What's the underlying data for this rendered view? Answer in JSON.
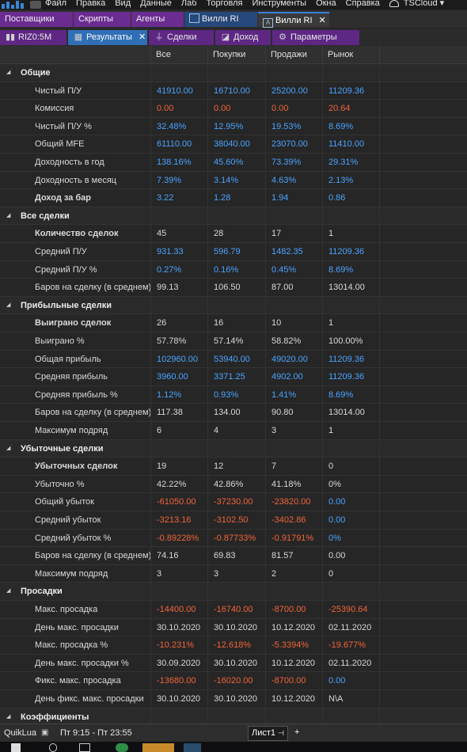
{
  "menu": [
    "Файл",
    "Правка",
    "Вид",
    "Данные",
    "Лаб",
    "Торговля",
    "Инструменты",
    "Окна",
    "Справка",
    "TSCloud ▾"
  ],
  "tabs_row1": [
    {
      "label": "Поставщики",
      "style": "purple"
    },
    {
      "label": "Скрипты",
      "style": "purple"
    },
    {
      "label": "Агенты",
      "style": "purple"
    },
    {
      "label": "Вилли RI",
      "style": "blue"
    },
    {
      "label": "Вилли RI",
      "style": "active"
    }
  ],
  "tabs_row2": [
    {
      "label": "RIZ0:5M",
      "icon": "bar-chart-icon"
    },
    {
      "label": "Результаты",
      "icon": "grid-icon",
      "active": true
    },
    {
      "label": "Сделки",
      "icon": "deals-icon"
    },
    {
      "label": "Доход",
      "icon": "chart-icon"
    },
    {
      "label": "Параметры",
      "icon": "gear-icon"
    }
  ],
  "columns": [
    "Все",
    "Покупки",
    "Продажи",
    "Рынок"
  ],
  "rows": [
    {
      "section": "Общие"
    },
    {
      "label": "Чистый П/У",
      "values": [
        "41910.00",
        "16710.00",
        "25200.00",
        "11209.36"
      ],
      "colors": [
        "pos",
        "pos",
        "pos",
        "pos"
      ]
    },
    {
      "label": "Комиссия",
      "values": [
        "0.00",
        "0.00",
        "0.00",
        "20.64"
      ],
      "colors": [
        "neg",
        "neg",
        "neg",
        "neg"
      ]
    },
    {
      "label": "Чистый П/У %",
      "values": [
        "32.48%",
        "12.95%",
        "19.53%",
        "8.69%"
      ],
      "colors": [
        "pos",
        "pos",
        "pos",
        "pos"
      ]
    },
    {
      "label": "Общий MFE",
      "values": [
        "61110.00",
        "38040.00",
        "23070.00",
        "11410.00"
      ],
      "colors": [
        "pos",
        "pos",
        "pos",
        "pos"
      ]
    },
    {
      "label": "Доходность в год",
      "values": [
        "138.16%",
        "45.60%",
        "73.39%",
        "29.31%"
      ],
      "colors": [
        "pos",
        "pos",
        "pos",
        "pos"
      ]
    },
    {
      "label": "Доходность в месяц",
      "values": [
        "7.39%",
        "3.14%",
        "4.63%",
        "2.13%"
      ],
      "colors": [
        "pos",
        "pos",
        "pos",
        "pos"
      ]
    },
    {
      "label": "Доход за бар",
      "bold": true,
      "values": [
        "3.22",
        "1.28",
        "1.94",
        "0.86"
      ],
      "colors": [
        "pos",
        "pos",
        "pos",
        "pos"
      ]
    },
    {
      "section": "Все сделки"
    },
    {
      "label": "Количество сделок",
      "bold": true,
      "values": [
        "45",
        "28",
        "17",
        "1"
      ],
      "colors": [
        "neu",
        "neu",
        "neu",
        "neu"
      ]
    },
    {
      "label": "Средний П/У",
      "values": [
        "931.33",
        "596.79",
        "1482.35",
        "11209.36"
      ],
      "colors": [
        "pos",
        "pos",
        "pos",
        "pos"
      ]
    },
    {
      "label": "Средний П/У %",
      "values": [
        "0.27%",
        "0.16%",
        "0.45%",
        "8.69%"
      ],
      "colors": [
        "pos",
        "pos",
        "pos",
        "pos"
      ]
    },
    {
      "label": "Баров на сделку (в среднем)",
      "values": [
        "99.13",
        "106.50",
        "87.00",
        "13014.00"
      ],
      "colors": [
        "neu",
        "neu",
        "neu",
        "neu"
      ]
    },
    {
      "section": "Прибыльные сделки"
    },
    {
      "label": "Выиграно сделок",
      "bold": true,
      "values": [
        "26",
        "16",
        "10",
        "1"
      ],
      "colors": [
        "neu",
        "neu",
        "neu",
        "neu"
      ]
    },
    {
      "label": "Выиграно %",
      "values": [
        "57.78%",
        "57.14%",
        "58.82%",
        "100.00%"
      ],
      "colors": [
        "neu",
        "neu",
        "neu",
        "neu"
      ]
    },
    {
      "label": "Общая прибыль",
      "values": [
        "102960.00",
        "53940.00",
        "49020.00",
        "11209.36"
      ],
      "colors": [
        "pos",
        "pos",
        "pos",
        "pos"
      ]
    },
    {
      "label": "Средняя прибыль",
      "values": [
        "3960.00",
        "3371.25",
        "4902.00",
        "11209.36"
      ],
      "colors": [
        "pos",
        "pos",
        "pos",
        "pos"
      ]
    },
    {
      "label": "Средняя прибыль %",
      "values": [
        "1.12%",
        "0.93%",
        "1.41%",
        "8.69%"
      ],
      "colors": [
        "pos",
        "pos",
        "pos",
        "pos"
      ]
    },
    {
      "label": "Баров на сделку (в среднем)",
      "values": [
        "117.38",
        "134.00",
        "90.80",
        "13014.00"
      ],
      "colors": [
        "neu",
        "neu",
        "neu",
        "neu"
      ]
    },
    {
      "label": "Максимум подряд",
      "values": [
        "6",
        "4",
        "3",
        "1"
      ],
      "colors": [
        "neu",
        "neu",
        "neu",
        "neu"
      ]
    },
    {
      "section": "Убыточные сделки"
    },
    {
      "label": "Убыточных сделок",
      "bold": true,
      "values": [
        "19",
        "12",
        "7",
        "0"
      ],
      "colors": [
        "neu",
        "neu",
        "neu",
        "neu"
      ]
    },
    {
      "label": "Убыточно %",
      "values": [
        "42.22%",
        "42.86%",
        "41.18%",
        "0%"
      ],
      "colors": [
        "neu",
        "neu",
        "neu",
        "neu"
      ]
    },
    {
      "label": "Общий убыток",
      "values": [
        "-61050.00",
        "-37230.00",
        "-23820.00",
        "0.00"
      ],
      "colors": [
        "neg",
        "neg",
        "neg",
        "pos"
      ]
    },
    {
      "label": "Средний убыток",
      "values": [
        "-3213.16",
        "-3102.50",
        "-3402.86",
        "0.00"
      ],
      "colors": [
        "neg",
        "neg",
        "neg",
        "pos"
      ]
    },
    {
      "label": "Средний убыток %",
      "values": [
        "-0.89228%",
        "-0.87733%",
        "-0.91791%",
        "0%"
      ],
      "colors": [
        "neg",
        "neg",
        "neg",
        "pos"
      ]
    },
    {
      "label": "Баров на сделку (в среднем)",
      "values": [
        "74.16",
        "69.83",
        "81.57",
        "0.00"
      ],
      "colors": [
        "neu",
        "neu",
        "neu",
        "neu"
      ]
    },
    {
      "label": "Максимум подряд",
      "values": [
        "3",
        "3",
        "2",
        "0"
      ],
      "colors": [
        "neu",
        "neu",
        "neu",
        "neu"
      ]
    },
    {
      "section": "Просадки"
    },
    {
      "label": "Макс. просадка",
      "values": [
        "-14400.00",
        "-16740.00",
        "-8700.00",
        "-25390.64"
      ],
      "colors": [
        "neg",
        "neg",
        "neg",
        "neg"
      ]
    },
    {
      "label": "День макс. просадки",
      "values": [
        "30.10.2020",
        "30.10.2020",
        "10.12.2020",
        "02.11.2020"
      ],
      "colors": [
        "neu",
        "neu",
        "neu",
        "neu"
      ]
    },
    {
      "label": "Макс. просадка %",
      "values": [
        "-10.231%",
        "-12.618%",
        "-5.3394%",
        "-19.677%"
      ],
      "colors": [
        "neg",
        "neg",
        "neg",
        "neg"
      ]
    },
    {
      "label": "День макс. просадки %",
      "values": [
        "30.09.2020",
        "30.10.2020",
        "10.12.2020",
        "02.11.2020"
      ],
      "colors": [
        "neu",
        "neu",
        "neu",
        "neu"
      ]
    },
    {
      "label": "Фикс. макс. просадка",
      "values": [
        "-13680.00",
        "-16020.00",
        "-8700.00",
        "0.00"
      ],
      "colors": [
        "neg",
        "neg",
        "neg",
        "pos"
      ]
    },
    {
      "label": "День фикс. макс. просадки",
      "values": [
        "30.10.2020",
        "30.10.2020",
        "10.12.2020",
        "N\\A"
      ],
      "colors": [
        "neu",
        "neu",
        "neu",
        "neu"
      ]
    },
    {
      "section": "Коэффициенты"
    }
  ],
  "status": {
    "left": "QuikLua",
    "session": "Пт 9:15 - Пт 23:55",
    "sheet": "Лист1",
    "add": "+"
  },
  "colors": {
    "positive": "#4aa3ff",
    "negative": "#f0643a",
    "tab_purple": "#6b2c91",
    "tab_blue": "#2f6fb5"
  }
}
